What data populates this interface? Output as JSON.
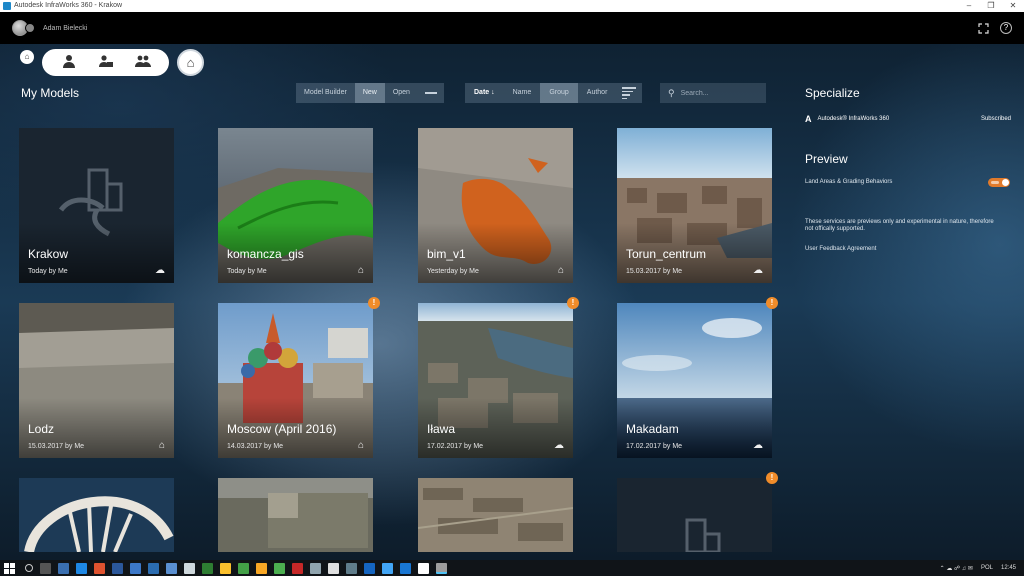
{
  "window": {
    "title": "Autodesk InfraWorks 360 - Krakow"
  },
  "header": {
    "username": "Adam Bielecki"
  },
  "main": {
    "title": "My Models",
    "toolbar": {
      "model_builder": "Model Builder",
      "new": "New",
      "open": "Open"
    },
    "sort": {
      "date": "Date ↓",
      "name": "Name",
      "group": "Group",
      "author": "Author"
    },
    "search": {
      "placeholder": "Search..."
    }
  },
  "models": [
    {
      "name": "Krakow",
      "meta": "Today by Me",
      "status": "cloud-icon"
    },
    {
      "name": "komancza_gis",
      "meta": "Today by Me",
      "status": "home-icon"
    },
    {
      "name": "bim_v1",
      "meta": "Yesterday by Me",
      "status": "home-icon"
    },
    {
      "name": "Torun_centrum",
      "meta": "15.03.2017 by Me",
      "status": "cloud-icon"
    },
    {
      "name": "Lodz",
      "meta": "15.03.2017 by Me",
      "status": "home-icon"
    },
    {
      "name": "Moscow (April 2016)",
      "meta": "14.03.2017 by Me",
      "status": "home-icon"
    },
    {
      "name": "Iława",
      "meta": "17.02.2017 by Me",
      "status": "cloud-icon"
    },
    {
      "name": "Makadam",
      "meta": "17.02.2017 by Me",
      "status": "cloud-icon"
    }
  ],
  "badge": "!",
  "panel": {
    "specialize_title": "Specialize",
    "product": "Autodesk® InfraWorks 360",
    "product_status": "Subscribed",
    "preview_title": "Preview",
    "preview_item": "Land Areas & Grading Behaviors",
    "preview_note_1": "These services are previews only and experimental in nature, therefore",
    "preview_note_2": "not offically supported.",
    "feedback_link": "User Feedback Agreement"
  },
  "taskbar": {
    "lang": "POL",
    "time": "12:45"
  }
}
